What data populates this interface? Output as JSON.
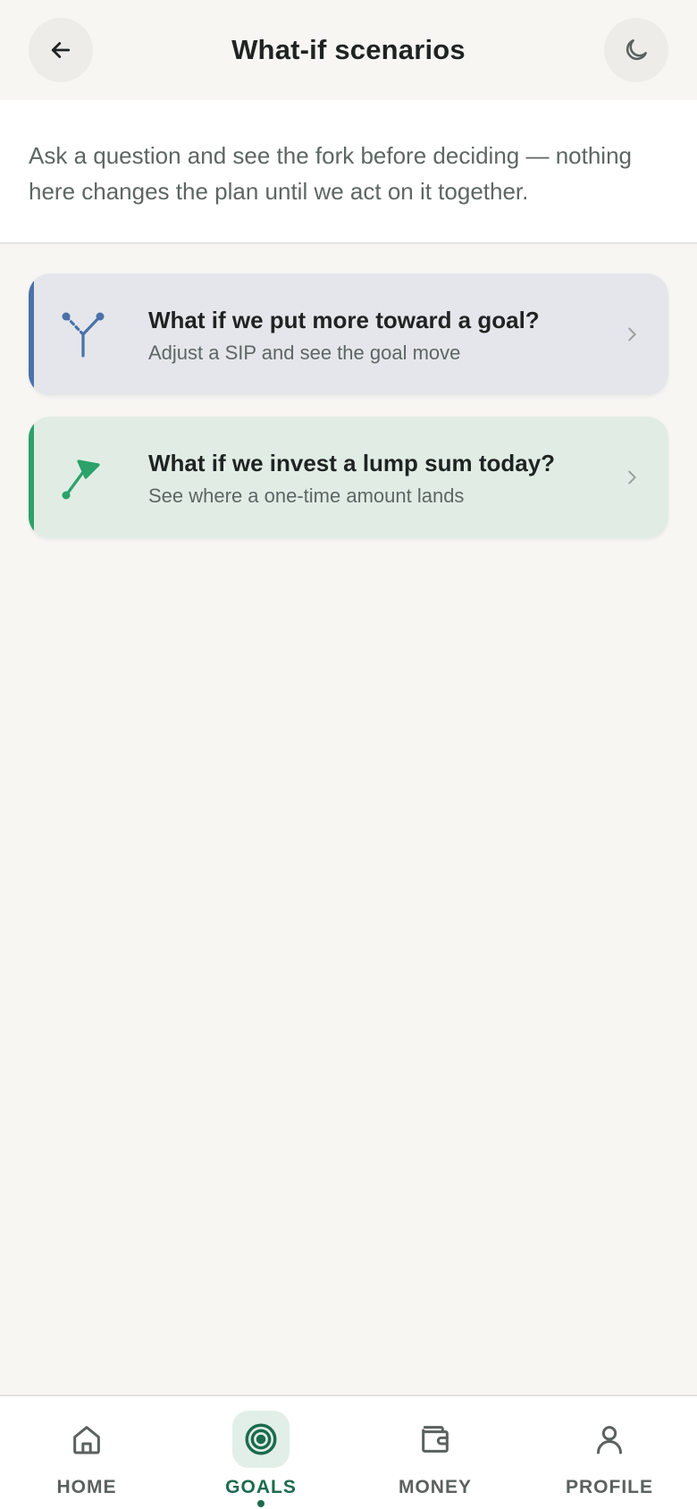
{
  "header": {
    "title": "What-if scenarios",
    "back_icon": "arrow-left-icon",
    "theme_icon": "moon-icon"
  },
  "intro": {
    "text": "Ask a question and see the fork before deciding — nothing here changes the plan until we act on it together."
  },
  "scenarios": [
    {
      "title": "What if we put more toward a goal?",
      "subtitle": "Adjust a SIP and see the goal move",
      "icon": "fork-branch-icon",
      "accent_color": "#4a72a8",
      "background": "#e5e6eb"
    },
    {
      "title": "What if we invest a lump sum today?",
      "subtitle": "See where a one-time amount lands",
      "icon": "trend-arrow-icon",
      "accent_color": "#2aa26a",
      "background": "#e1ede4"
    }
  ],
  "nav": {
    "items": [
      {
        "label": "HOME",
        "icon": "home-icon",
        "active": false
      },
      {
        "label": "GOALS",
        "icon": "target-icon",
        "active": true
      },
      {
        "label": "MONEY",
        "icon": "wallet-icon",
        "active": false
      },
      {
        "label": "PROFILE",
        "icon": "user-icon",
        "active": false
      }
    ],
    "active_color": "#1c6b4e"
  }
}
